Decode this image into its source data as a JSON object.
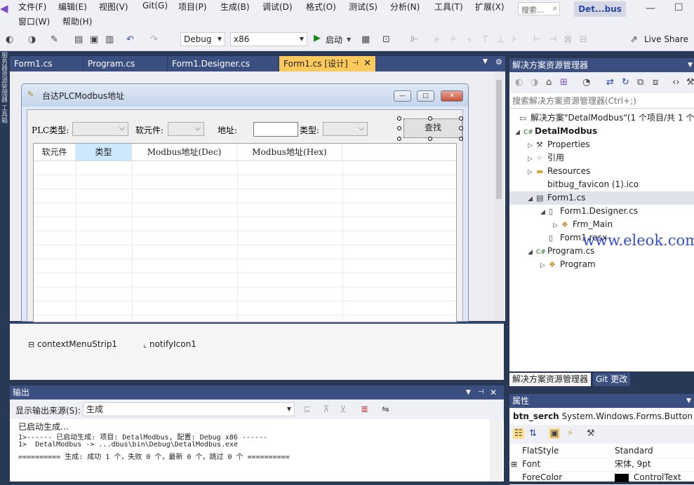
{
  "menu": {
    "row1": [
      "文件(F)",
      "编辑(E)",
      "视图(V)",
      "Git(G)",
      "项目(P)",
      "生成(B)",
      "调试(D)",
      "格式(O)",
      "测试(S)",
      "分析(N)",
      "工具(T)",
      "扩展(X)"
    ],
    "row2": [
      "窗口(W)",
      "帮助(H)"
    ],
    "search_placeholder": "搜索...",
    "solution_badge": "Det...bus"
  },
  "toolbar": {
    "config": "Debug",
    "platform": "x86",
    "start_label": "启动",
    "live_share": "Live Share"
  },
  "left_strip": "服务器资源管理器 工具箱",
  "doc_tabs": [
    "Form1.cs",
    "Program.cs",
    "Form1.Designer.cs",
    "Form1.cs [设计]"
  ],
  "form": {
    "title": "台达PLCModbus地址",
    "labels": {
      "plc_type": "PLC类型:",
      "element": "软元件:",
      "address": "地址:",
      "type": "类型:"
    },
    "search_button": "查找",
    "grid_headers": [
      "软元件",
      "类型",
      "Modbus地址(Dec)",
      "Modbus地址(Hex)"
    ]
  },
  "tray": {
    "items": [
      "contextMenuStrip1",
      "notifyIcon1"
    ]
  },
  "output": {
    "title": "输出",
    "source_label": "显示输出来源(S):",
    "source_value": "生成",
    "lines": [
      "已启动生成…",
      "1>------ 已启动生成: 项目: DetalModbus, 配置: Debug x86 ------",
      "1>  DetalModbus -> ...dbus\\bin\\Debug\\DetalModbus.exe",
      "========== 生成: 成功 1 个，失败 0 个，最新 0 个，跳过 0 个 =========="
    ]
  },
  "solution_explorer": {
    "title": "解决方案资源管理器",
    "search_placeholder": "搜索解决方案资源管理器(Ctrl+;)",
    "items": [
      {
        "label": "解决方案\"DetalModbus\"(1 个项目/共 1 个",
        "level": 0,
        "expander": "",
        "icon": "solution-icon"
      },
      {
        "label": "DetalModbus",
        "level": 0,
        "expander": "◢",
        "icon": "csharp-project-icon"
      },
      {
        "label": "Properties",
        "level": 1,
        "expander": "▷",
        "icon": "wrench-icon"
      },
      {
        "label": "引用",
        "level": 1,
        "expander": "▷",
        "icon": "references-icon"
      },
      {
        "label": "Resources",
        "level": 1,
        "expander": "▷",
        "icon": "folder-icon"
      },
      {
        "label": "bitbug_favicon (1).ico",
        "level": 1,
        "expander": "",
        "icon": "ico-file-icon"
      },
      {
        "label": "Form1.cs",
        "level": 1,
        "expander": "◢",
        "icon": "form-icon"
      },
      {
        "label": "Form1.Designer.cs",
        "level": 2,
        "expander": "◢",
        "icon": "cs-file-icon"
      },
      {
        "label": "Frm_Main",
        "level": 3,
        "expander": "▷",
        "icon": "class-icon"
      },
      {
        "label": "Form1.resx",
        "level": 2,
        "expander": "",
        "icon": "resx-file-icon"
      },
      {
        "label": "Program.cs",
        "level": 1,
        "expander": "◢",
        "icon": "csharp-file-icon"
      },
      {
        "label": "Program",
        "level": 2,
        "expander": "▷",
        "icon": "class-icon"
      }
    ],
    "tabs": [
      "解决方案资源管理器",
      "Git 更改"
    ]
  },
  "watermark": "www.eleok.com",
  "properties": {
    "title": "属性",
    "object_name": "btn_serch",
    "object_type": "System.Windows.Forms.Button",
    "rows": [
      {
        "name": "FlatStyle",
        "value": "Standard",
        "expander": ""
      },
      {
        "name": "Font",
        "value": "宋体, 9pt",
        "expander": "⊞"
      },
      {
        "name": "ForeColor",
        "value": "ControlText",
        "expander": ""
      }
    ]
  },
  "colors": {
    "accent_tab": "#fcca5c",
    "panel_header": "#3b4f81",
    "ide_background": "#293955"
  }
}
